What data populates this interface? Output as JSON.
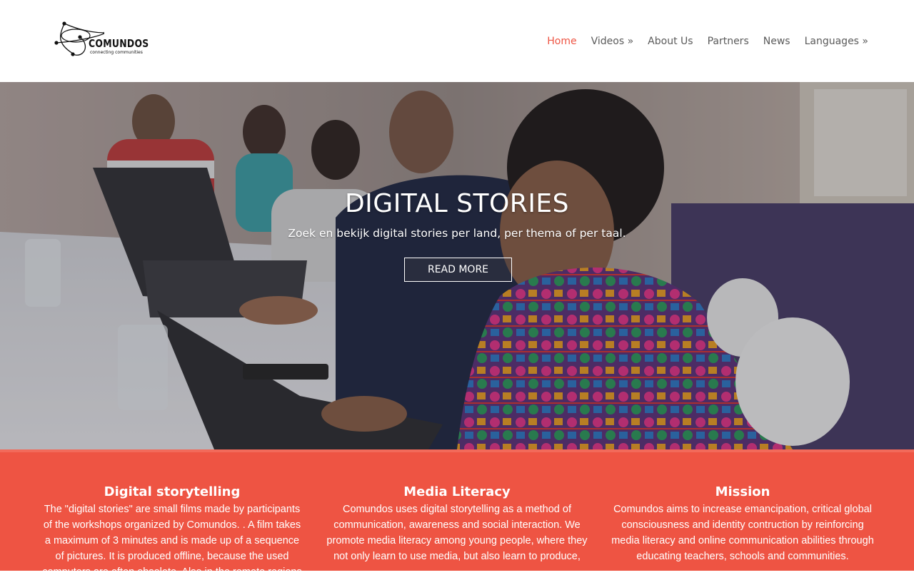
{
  "brand": {
    "name": "COMUNDOS",
    "tagline": "connecting communities"
  },
  "nav": {
    "items": [
      {
        "label": "Home",
        "active": true
      },
      {
        "label": "Videos »",
        "active": false
      },
      {
        "label": "About Us",
        "active": false
      },
      {
        "label": "Partners",
        "active": false
      },
      {
        "label": "News",
        "active": false
      },
      {
        "label": "Languages »",
        "active": false
      }
    ]
  },
  "hero": {
    "title": "DIGITAL STORIES",
    "subtitle": "Zoek en bekijk digital stories per land, per thema of per taal.",
    "button_label": "READ MORE"
  },
  "features": [
    {
      "title": "Digital storytelling",
      "text": "The \"digital stories\" are small films made by participants of the workshops organized by Comundos. . A film takes a maximum of 3 minutes and is made up of a sequence of pictures. It is produced offline, because the used computers are often obsolete. Also in the remote regions"
    },
    {
      "title": "Media Literacy",
      "text": "Comundos uses digital storytelling as a method of communication, awareness and social interaction. We promote media literacy among young people, where they not only learn to use media, but also learn to produce,"
    },
    {
      "title": "Mission",
      "text": "Comundos aims to increase emancipation, critical global consciousness and identity contruction by reinforcing media literacy and online communication abilities through educating teachers, schools and communities."
    }
  ],
  "colors": {
    "accent": "#ee5443",
    "nav_text": "#5a5a5a",
    "band": "#ee5443"
  }
}
